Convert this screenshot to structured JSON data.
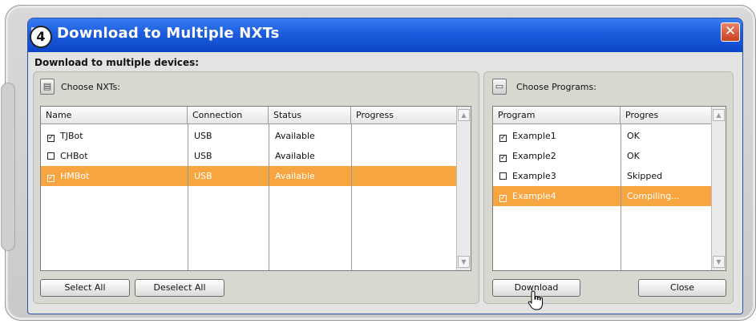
{
  "window": {
    "title": "Download to Multiple NXTs",
    "step_badge": "4",
    "close_glyph": "✕"
  },
  "main": {
    "heading": "Download to multiple devices:"
  },
  "nxt_panel": {
    "label": "Choose NXTs:",
    "icon": "nxt-brick-icon",
    "columns": [
      "Name",
      "Connection",
      "Status",
      "Progress"
    ],
    "rows": [
      {
        "checked": true,
        "name": "TJBot",
        "connection": "USB",
        "status": "Available",
        "progress": ""
      },
      {
        "checked": false,
        "name": "CHBot",
        "connection": "USB",
        "status": "Available",
        "progress": ""
      },
      {
        "checked": true,
        "name": "HMBot",
        "connection": "USB",
        "status": "Available",
        "progress": "",
        "selected": true
      }
    ],
    "select_all_label": "Select All",
    "deselect_all_label": "Deselect All"
  },
  "program_panel": {
    "label": "Choose Programs:",
    "icon": "folder-icon",
    "columns": [
      "Program",
      "Progres"
    ],
    "rows": [
      {
        "checked": true,
        "program": "Example1",
        "progress": "OK"
      },
      {
        "checked": true,
        "program": "Example2",
        "progress": "OK"
      },
      {
        "checked": false,
        "program": "Example3",
        "progress": "Skipped"
      },
      {
        "checked": true,
        "program": "Example4",
        "progress": "Compiling...",
        "selected": true
      }
    ],
    "download_label": "Download",
    "close_label": "Close"
  },
  "colors": {
    "titlebar": "#1e5fe0",
    "selection": "#f7a541",
    "close_button": "#c8431f"
  }
}
